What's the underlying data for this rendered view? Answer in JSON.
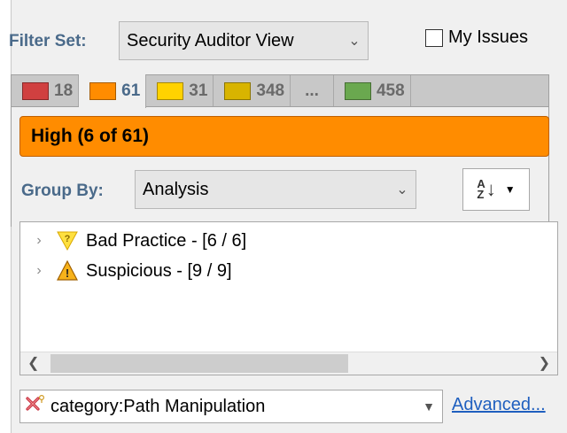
{
  "filter": {
    "label": "Filter Set:",
    "selected": "Security Auditor View",
    "my_issues_label": "My Issues"
  },
  "tabs": [
    {
      "count": "18",
      "color": "#d04040"
    },
    {
      "count": "61",
      "color": "#ff8c00",
      "active": true
    },
    {
      "count": "31",
      "color": "#ffd200"
    },
    {
      "count": "348",
      "color": "#d8b400"
    },
    {
      "count": "..."
    },
    {
      "count": "458",
      "color": "#6aa84f"
    }
  ],
  "severity_bar": {
    "text": "High (6 of 61)",
    "color": "#ff8c00"
  },
  "group_by": {
    "label": "Group By:",
    "selected": "Analysis"
  },
  "sort_button": {
    "icon": "sort-az-icon"
  },
  "tree": {
    "items": [
      {
        "label": "Bad Practice - [6 / 6]",
        "icon": "bad-practice-icon"
      },
      {
        "label": "Suspicious - [9 / 9]",
        "icon": "suspicious-warning-icon"
      }
    ]
  },
  "search": {
    "value": "category:Path Manipulation",
    "advanced_label": "Advanced..."
  }
}
